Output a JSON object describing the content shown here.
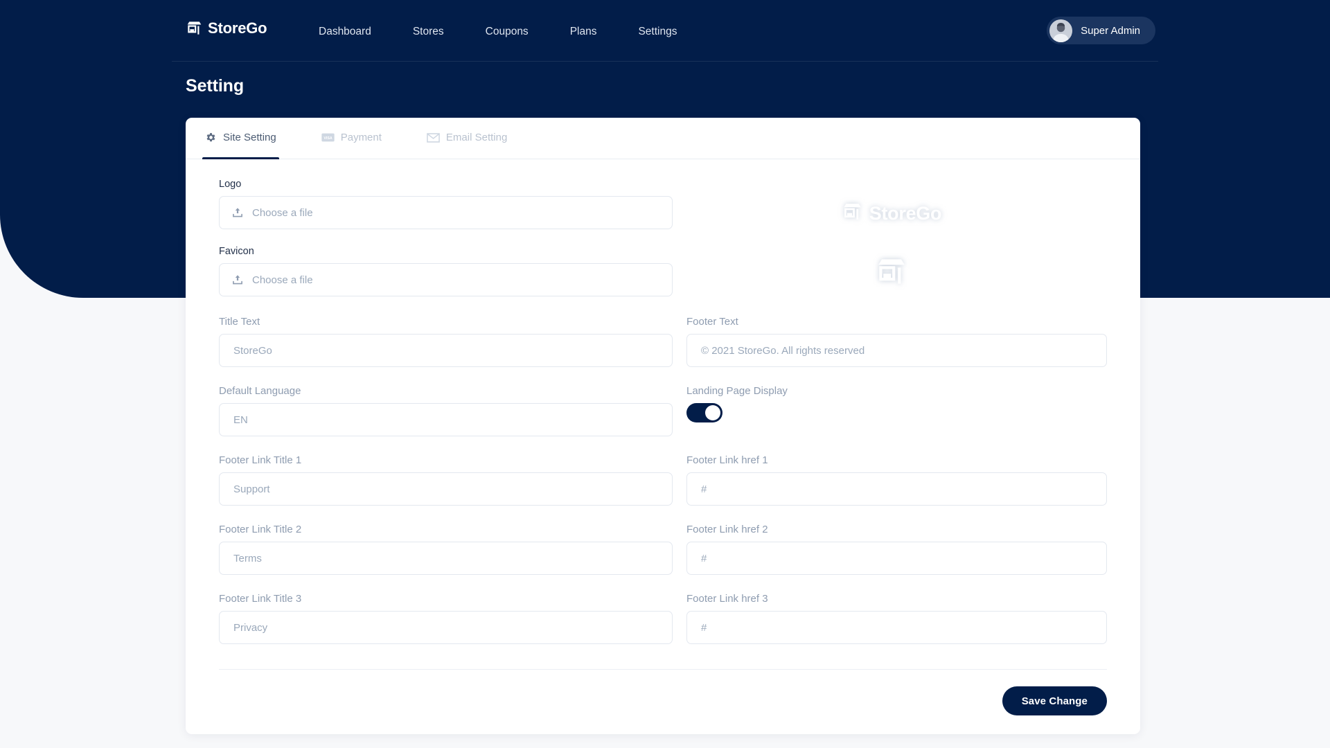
{
  "brand": {
    "name": "StoreGo",
    "icon": "storefront-icon"
  },
  "navbar": {
    "links": [
      {
        "label": "Dashboard"
      },
      {
        "label": "Stores"
      },
      {
        "label": "Coupons"
      },
      {
        "label": "Plans"
      },
      {
        "label": "Settings"
      }
    ],
    "user": {
      "name": "Super Admin",
      "avatar_icon": "user-avatar-icon"
    }
  },
  "page": {
    "title": "Setting"
  },
  "tabs": [
    {
      "label": "Site Setting",
      "icon": "gear-icon",
      "active": true
    },
    {
      "label": "Payment",
      "icon": "visa-card-icon",
      "active": false
    },
    {
      "label": "Email Setting",
      "icon": "envelope-icon",
      "active": false
    }
  ],
  "uploads": [
    {
      "label": "Logo",
      "placeholder": "Choose a file",
      "icon": "upload-icon"
    },
    {
      "label": "Favicon",
      "placeholder": "Choose a file",
      "icon": "upload-icon"
    }
  ],
  "previews": {
    "logo_text": "StoreGo",
    "logo_icon": "storefront-icon",
    "favicon_icon": "storefront-icon"
  },
  "form": {
    "title_text": {
      "label": "Title Text",
      "value": "StoreGo",
      "placeholder": "StoreGo"
    },
    "footer_text": {
      "label": "Footer Text",
      "value": "© 2021 StoreGo. All rights reserved",
      "placeholder": "© 2021 StoreGo. All rights reserved"
    },
    "default_language": {
      "label": "Default Language",
      "value": "EN",
      "placeholder": "EN"
    },
    "landing_page_display": {
      "label": "Landing Page Display",
      "enabled": true
    },
    "footer_link_title_1": {
      "label": "Footer Link Title 1",
      "value": "Support",
      "placeholder": "Support"
    },
    "footer_link_href_1": {
      "label": "Footer Link href 1",
      "value": "#",
      "placeholder": "#"
    },
    "footer_link_title_2": {
      "label": "Footer Link Title 2",
      "value": "Terms",
      "placeholder": "Terms"
    },
    "footer_link_href_2": {
      "label": "Footer Link href 2",
      "value": "#",
      "placeholder": "#"
    },
    "footer_link_title_3": {
      "label": "Footer Link Title 3",
      "value": "Privacy",
      "placeholder": "Privacy"
    },
    "footer_link_href_3": {
      "label": "Footer Link href 3",
      "value": "#",
      "placeholder": "#"
    }
  },
  "actions": {
    "save_label": "Save Change"
  },
  "colors": {
    "navy": "#021d49",
    "chip": "#1b3560",
    "page_bg": "#f7f8fa",
    "border": "#e3e8ef",
    "label_muted": "#8e9cb0",
    "input_text": "#7e8da2"
  }
}
